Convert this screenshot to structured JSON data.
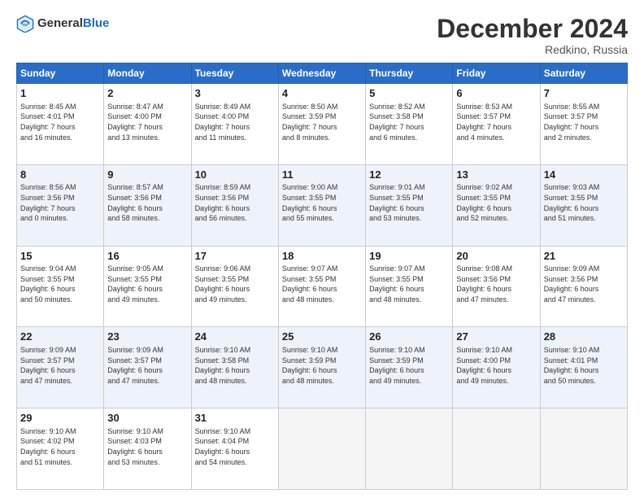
{
  "header": {
    "logo_general": "General",
    "logo_blue": "Blue",
    "month": "December 2024",
    "location": "Redkino, Russia"
  },
  "days_of_week": [
    "Sunday",
    "Monday",
    "Tuesday",
    "Wednesday",
    "Thursday",
    "Friday",
    "Saturday"
  ],
  "weeks": [
    [
      {
        "day": "1",
        "lines": [
          "Sunrise: 8:45 AM",
          "Sunset: 4:01 PM",
          "Daylight: 7 hours",
          "and 16 minutes."
        ]
      },
      {
        "day": "2",
        "lines": [
          "Sunrise: 8:47 AM",
          "Sunset: 4:00 PM",
          "Daylight: 7 hours",
          "and 13 minutes."
        ]
      },
      {
        "day": "3",
        "lines": [
          "Sunrise: 8:49 AM",
          "Sunset: 4:00 PM",
          "Daylight: 7 hours",
          "and 11 minutes."
        ]
      },
      {
        "day": "4",
        "lines": [
          "Sunrise: 8:50 AM",
          "Sunset: 3:59 PM",
          "Daylight: 7 hours",
          "and 8 minutes."
        ]
      },
      {
        "day": "5",
        "lines": [
          "Sunrise: 8:52 AM",
          "Sunset: 3:58 PM",
          "Daylight: 7 hours",
          "and 6 minutes."
        ]
      },
      {
        "day": "6",
        "lines": [
          "Sunrise: 8:53 AM",
          "Sunset: 3:57 PM",
          "Daylight: 7 hours",
          "and 4 minutes."
        ]
      },
      {
        "day": "7",
        "lines": [
          "Sunrise: 8:55 AM",
          "Sunset: 3:57 PM",
          "Daylight: 7 hours",
          "and 2 minutes."
        ]
      }
    ],
    [
      {
        "day": "8",
        "lines": [
          "Sunrise: 8:56 AM",
          "Sunset: 3:56 PM",
          "Daylight: 7 hours",
          "and 0 minutes."
        ]
      },
      {
        "day": "9",
        "lines": [
          "Sunrise: 8:57 AM",
          "Sunset: 3:56 PM",
          "Daylight: 6 hours",
          "and 58 minutes."
        ]
      },
      {
        "day": "10",
        "lines": [
          "Sunrise: 8:59 AM",
          "Sunset: 3:56 PM",
          "Daylight: 6 hours",
          "and 56 minutes."
        ]
      },
      {
        "day": "11",
        "lines": [
          "Sunrise: 9:00 AM",
          "Sunset: 3:55 PM",
          "Daylight: 6 hours",
          "and 55 minutes."
        ]
      },
      {
        "day": "12",
        "lines": [
          "Sunrise: 9:01 AM",
          "Sunset: 3:55 PM",
          "Daylight: 6 hours",
          "and 53 minutes."
        ]
      },
      {
        "day": "13",
        "lines": [
          "Sunrise: 9:02 AM",
          "Sunset: 3:55 PM",
          "Daylight: 6 hours",
          "and 52 minutes."
        ]
      },
      {
        "day": "14",
        "lines": [
          "Sunrise: 9:03 AM",
          "Sunset: 3:55 PM",
          "Daylight: 6 hours",
          "and 51 minutes."
        ]
      }
    ],
    [
      {
        "day": "15",
        "lines": [
          "Sunrise: 9:04 AM",
          "Sunset: 3:55 PM",
          "Daylight: 6 hours",
          "and 50 minutes."
        ]
      },
      {
        "day": "16",
        "lines": [
          "Sunrise: 9:05 AM",
          "Sunset: 3:55 PM",
          "Daylight: 6 hours",
          "and 49 minutes."
        ]
      },
      {
        "day": "17",
        "lines": [
          "Sunrise: 9:06 AM",
          "Sunset: 3:55 PM",
          "Daylight: 6 hours",
          "and 49 minutes."
        ]
      },
      {
        "day": "18",
        "lines": [
          "Sunrise: 9:07 AM",
          "Sunset: 3:55 PM",
          "Daylight: 6 hours",
          "and 48 minutes."
        ]
      },
      {
        "day": "19",
        "lines": [
          "Sunrise: 9:07 AM",
          "Sunset: 3:55 PM",
          "Daylight: 6 hours",
          "and 48 minutes."
        ]
      },
      {
        "day": "20",
        "lines": [
          "Sunrise: 9:08 AM",
          "Sunset: 3:56 PM",
          "Daylight: 6 hours",
          "and 47 minutes."
        ]
      },
      {
        "day": "21",
        "lines": [
          "Sunrise: 9:09 AM",
          "Sunset: 3:56 PM",
          "Daylight: 6 hours",
          "and 47 minutes."
        ]
      }
    ],
    [
      {
        "day": "22",
        "lines": [
          "Sunrise: 9:09 AM",
          "Sunset: 3:57 PM",
          "Daylight: 6 hours",
          "and 47 minutes."
        ]
      },
      {
        "day": "23",
        "lines": [
          "Sunrise: 9:09 AM",
          "Sunset: 3:57 PM",
          "Daylight: 6 hours",
          "and 47 minutes."
        ]
      },
      {
        "day": "24",
        "lines": [
          "Sunrise: 9:10 AM",
          "Sunset: 3:58 PM",
          "Daylight: 6 hours",
          "and 48 minutes."
        ]
      },
      {
        "day": "25",
        "lines": [
          "Sunrise: 9:10 AM",
          "Sunset: 3:59 PM",
          "Daylight: 6 hours",
          "and 48 minutes."
        ]
      },
      {
        "day": "26",
        "lines": [
          "Sunrise: 9:10 AM",
          "Sunset: 3:59 PM",
          "Daylight: 6 hours",
          "and 49 minutes."
        ]
      },
      {
        "day": "27",
        "lines": [
          "Sunrise: 9:10 AM",
          "Sunset: 4:00 PM",
          "Daylight: 6 hours",
          "and 49 minutes."
        ]
      },
      {
        "day": "28",
        "lines": [
          "Sunrise: 9:10 AM",
          "Sunset: 4:01 PM",
          "Daylight: 6 hours",
          "and 50 minutes."
        ]
      }
    ],
    [
      {
        "day": "29",
        "lines": [
          "Sunrise: 9:10 AM",
          "Sunset: 4:02 PM",
          "Daylight: 6 hours",
          "and 51 minutes."
        ]
      },
      {
        "day": "30",
        "lines": [
          "Sunrise: 9:10 AM",
          "Sunset: 4:03 PM",
          "Daylight: 6 hours",
          "and 53 minutes."
        ]
      },
      {
        "day": "31",
        "lines": [
          "Sunrise: 9:10 AM",
          "Sunset: 4:04 PM",
          "Daylight: 6 hours",
          "and 54 minutes."
        ]
      },
      null,
      null,
      null,
      null
    ]
  ]
}
